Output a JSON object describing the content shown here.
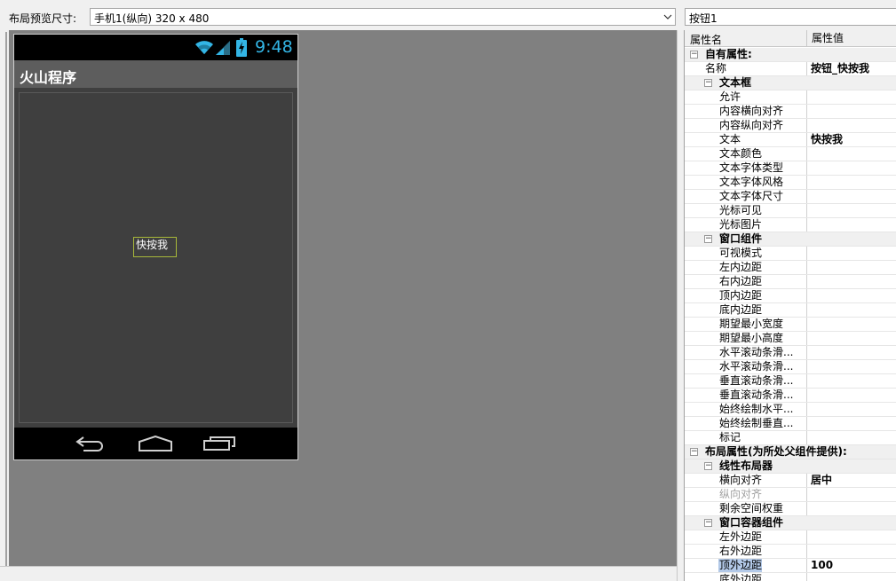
{
  "toolbar": {
    "size_label": "布局预览尺寸:",
    "size_value": "手机1(纵向) 320 x 480",
    "component_name": "按钮1"
  },
  "phone": {
    "time": "9:48",
    "app_title": "火山程序",
    "button_text": "快按我"
  },
  "properties": {
    "header_name": "属性名",
    "header_value": "属性值",
    "rows": [
      {
        "label": "自有属性:",
        "value": "",
        "kind": "group",
        "level": 0
      },
      {
        "label": "名称",
        "value": "按钮_快按我",
        "kind": "prop",
        "level": 1
      },
      {
        "label": "文本框",
        "value": "",
        "kind": "group",
        "level": 1
      },
      {
        "label": "允许",
        "value": "",
        "kind": "prop",
        "level": 2
      },
      {
        "label": "内容横向对齐",
        "value": "",
        "kind": "prop",
        "level": 2
      },
      {
        "label": "内容纵向对齐",
        "value": "",
        "kind": "prop",
        "level": 2
      },
      {
        "label": "文本",
        "value": "快按我",
        "kind": "prop",
        "level": 2
      },
      {
        "label": "文本颜色",
        "value": "",
        "kind": "prop",
        "level": 2
      },
      {
        "label": "文本字体类型",
        "value": "",
        "kind": "prop",
        "level": 2
      },
      {
        "label": "文本字体风格",
        "value": "",
        "kind": "prop",
        "level": 2
      },
      {
        "label": "文本字体尺寸",
        "value": "",
        "kind": "prop",
        "level": 2
      },
      {
        "label": "光标可见",
        "value": "",
        "kind": "prop",
        "level": 2
      },
      {
        "label": "光标图片",
        "value": "",
        "kind": "prop",
        "level": 2
      },
      {
        "label": "窗口组件",
        "value": "",
        "kind": "group",
        "level": 1
      },
      {
        "label": "可视模式",
        "value": "",
        "kind": "prop",
        "level": 2
      },
      {
        "label": "左内边距",
        "value": "",
        "kind": "prop",
        "level": 2
      },
      {
        "label": "右内边距",
        "value": "",
        "kind": "prop",
        "level": 2
      },
      {
        "label": "顶内边距",
        "value": "",
        "kind": "prop",
        "level": 2
      },
      {
        "label": "底内边距",
        "value": "",
        "kind": "prop",
        "level": 2
      },
      {
        "label": "期望最小宽度",
        "value": "",
        "kind": "prop",
        "level": 2
      },
      {
        "label": "期望最小高度",
        "value": "",
        "kind": "prop",
        "level": 2
      },
      {
        "label": "水平滚动条滑...",
        "value": "",
        "kind": "prop",
        "level": 2
      },
      {
        "label": "水平滚动条滑...",
        "value": "",
        "kind": "prop",
        "level": 2
      },
      {
        "label": "垂直滚动条滑...",
        "value": "",
        "kind": "prop",
        "level": 2
      },
      {
        "label": "垂直滚动条滑...",
        "value": "",
        "kind": "prop",
        "level": 2
      },
      {
        "label": "始终绘制水平...",
        "value": "",
        "kind": "prop",
        "level": 2
      },
      {
        "label": "始终绘制垂直...",
        "value": "",
        "kind": "prop",
        "level": 2
      },
      {
        "label": "标记",
        "value": "",
        "kind": "prop",
        "level": 2
      },
      {
        "label": "布局属性(为所处父组件提供):",
        "value": "",
        "kind": "group",
        "level": 0
      },
      {
        "label": "线性布局器",
        "value": "",
        "kind": "group",
        "level": 1
      },
      {
        "label": "横向对齐",
        "value": "居中",
        "kind": "prop",
        "level": 2
      },
      {
        "label": "纵向对齐",
        "value": "",
        "kind": "disabled",
        "level": 2
      },
      {
        "label": "剩余空间权重",
        "value": "",
        "kind": "prop",
        "level": 2
      },
      {
        "label": "窗口容器组件",
        "value": "",
        "kind": "group",
        "level": 1
      },
      {
        "label": "左外边距",
        "value": "",
        "kind": "prop",
        "level": 2
      },
      {
        "label": "右外边距",
        "value": "",
        "kind": "prop",
        "level": 2
      },
      {
        "label": "顶外边距",
        "value": "100",
        "kind": "selected",
        "level": 2
      },
      {
        "label": "底外边距",
        "value": "",
        "kind": "prop",
        "level": 2
      }
    ]
  }
}
